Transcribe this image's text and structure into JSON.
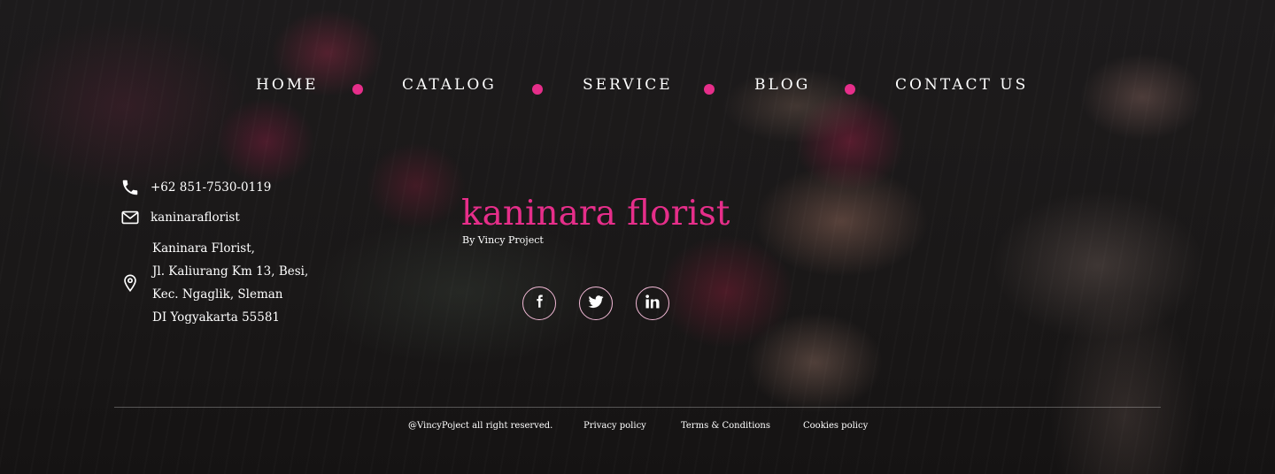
{
  "nav": {
    "items": [
      "HOME",
      "CATALOG",
      "SERVICE",
      "BLOG",
      "CONTACT US"
    ]
  },
  "contact": {
    "phone": "+62 851-7530-0119",
    "email": "kaninaraflorist",
    "address_lines": [
      "Kaninara Florist,",
      "Jl. Kaliurang Km 13, Besi,",
      "Kec. Ngaglik, Sleman",
      "DI Yogyakarta 55581"
    ],
    "icons": [
      "phone-icon",
      "mail-icon",
      "location-pin-icon"
    ]
  },
  "brand": {
    "title": "kaninara florist",
    "subtitle": "By Vincy Project"
  },
  "social": {
    "icons": [
      "facebook-icon",
      "twitter-icon",
      "linkedin-icon"
    ]
  },
  "footer": {
    "copyright": "@VincyPoject all right reserved.",
    "links": [
      "Privacy policy",
      "Terms & Conditions",
      "Cookies policy"
    ]
  },
  "colors": {
    "accent": "#e62e8a",
    "social_border": "#f2b9d6",
    "text": "#ffffff"
  }
}
